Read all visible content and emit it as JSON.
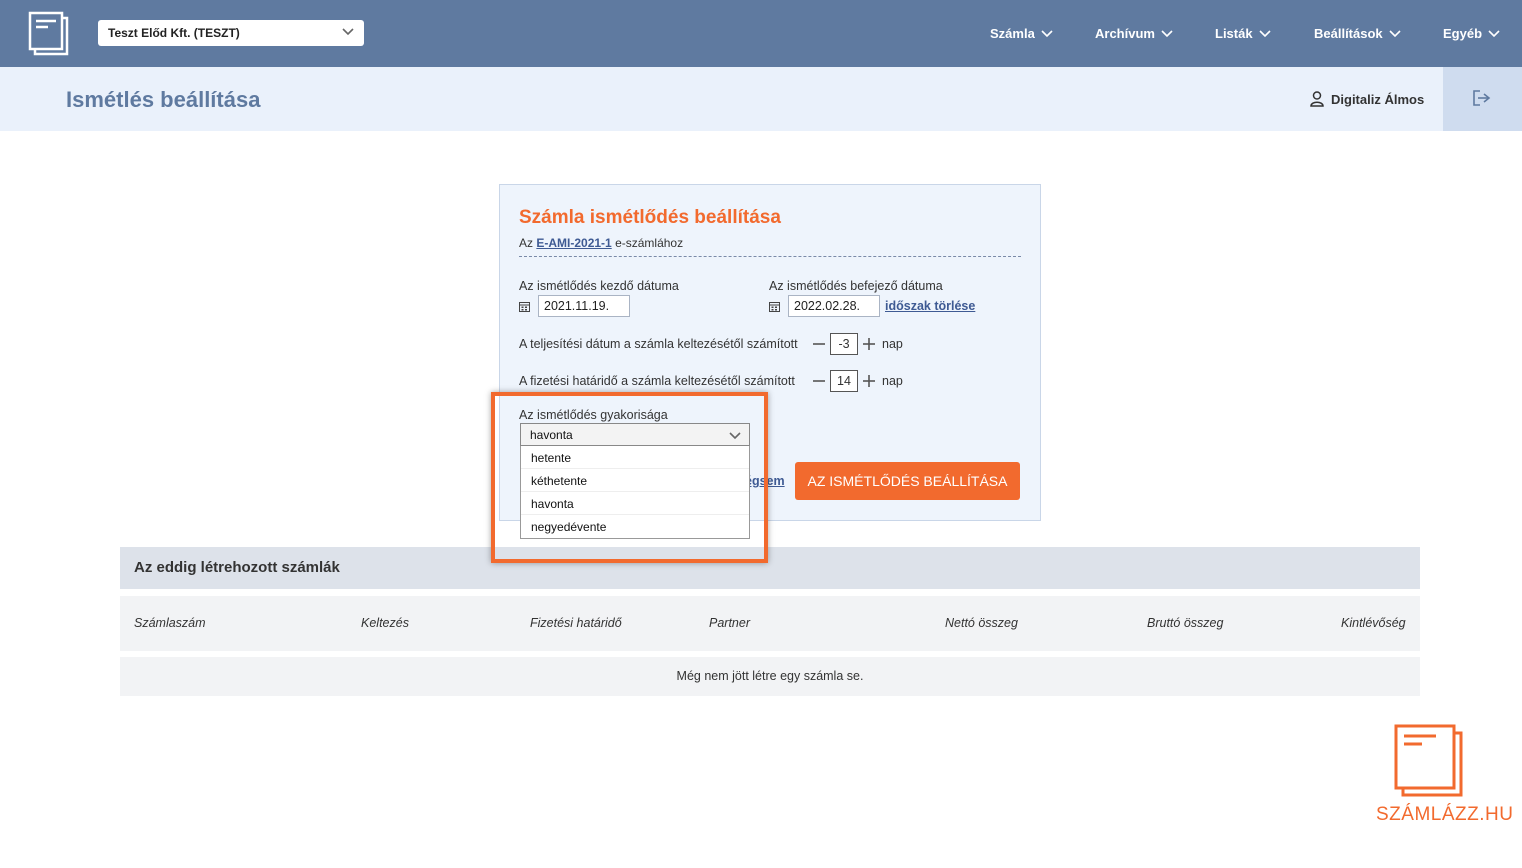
{
  "topbar": {
    "company": "Teszt Előd Kft. (TESZT)",
    "menu": [
      "Számla",
      "Archívum",
      "Listák",
      "Beállítások",
      "Egyéb"
    ]
  },
  "header": {
    "title": "Ismétlés beállítása",
    "user": "Digitaliz Álmos"
  },
  "card": {
    "title": "Számla ismétlődés beállítása",
    "sub_prefix": "Az",
    "invoice_link": "E-AMI-2021-1",
    "sub_suffix": "e-számlához",
    "start_label": "Az ismétlődés kezdő dátuma",
    "start_value": "2021.11.19.",
    "end_label": "Az ismétlődés befejező dátuma",
    "end_value": "2022.02.28.",
    "clear_period": "időszak törlése",
    "perf_label": "A teljesítési dátum a számla keltezésétől számított",
    "perf_value": "-3",
    "due_label": "A fizetési határidő a számla keltezésétől számított",
    "due_value": "14",
    "unit": "nap",
    "freq_label": "Az ismétlődés gyakorisága",
    "freq_value": "havonta",
    "freq_options": [
      "hetente",
      "kéthetente",
      "havonta",
      "negyedévente"
    ],
    "cancel_partial": "égsem",
    "submit": "AZ ISMÉTLŐDÉS BEÁLLÍTÁSA"
  },
  "table": {
    "title": "Az eddig létrehozott számlák",
    "columns": [
      "Számlaszám",
      "Keltezés",
      "Fizetési határidő",
      "Partner",
      "Nettó összeg",
      "Bruttó összeg",
      "Kintlévőség"
    ],
    "empty": "Még nem jött létre egy számla se."
  },
  "brand": {
    "name": "SZÁMLÁZZ.HU"
  },
  "colors": {
    "accent": "#f26a2e",
    "topbar": "#5f7aa0",
    "link": "#3e5a93"
  }
}
